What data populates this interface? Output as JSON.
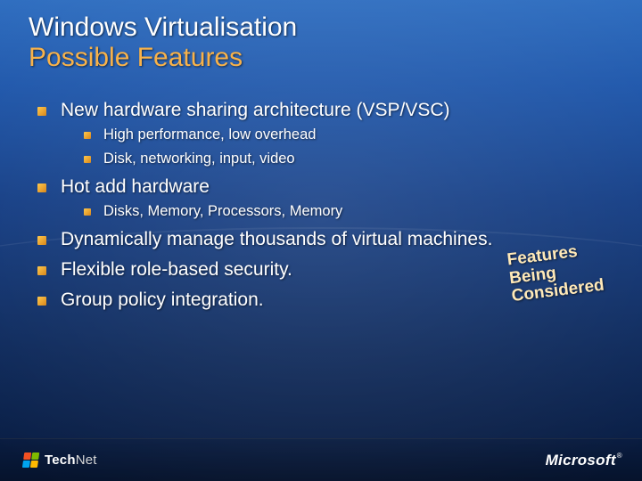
{
  "title": {
    "line1": "Windows Virtualisation",
    "line2": "Possible Features"
  },
  "bullets": {
    "b1": "New hardware sharing architecture (VSP/VSC)",
    "b1_children": {
      "c1": "High performance, low overhead",
      "c2": "Disk, networking, input, video"
    },
    "b2": "Hot add hardware",
    "b2_children": {
      "c1": "Disks, Memory, Processors, Memory"
    },
    "b3": "Dynamically manage thousands of virtual machines.",
    "b4": "Flexible role-based security.",
    "b5": "Group policy integration."
  },
  "stamp": {
    "line1": "Features",
    "line2": "Being",
    "line3": "Considered"
  },
  "footer": {
    "technet_bold": "Tech",
    "technet_rest": "Net",
    "brand": "Microsoft",
    "reg": "®"
  }
}
